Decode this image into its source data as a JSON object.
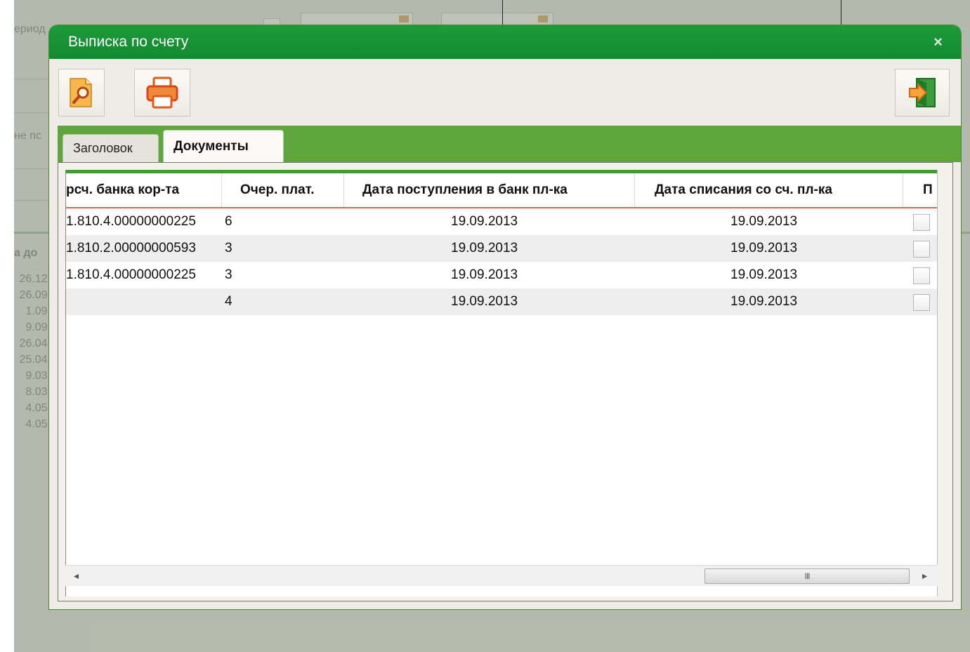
{
  "background": {
    "period_label": "ериод",
    "side_label": "не пс",
    "column_header_partial": "а до",
    "date_fragments": [
      "26.12.",
      "26.09.",
      "1.09.",
      "9.09.",
      "26.04.",
      "25.04.",
      "9.03.",
      "8.03.",
      "4.05.",
      "4.05."
    ]
  },
  "dialog": {
    "title": "Выписка по счету",
    "close_icon": "×"
  },
  "toolbar": {
    "search_icon": "search-icon",
    "print_icon": "print-icon",
    "exit_icon": "exit-icon"
  },
  "tabs": [
    {
      "label": "Заголовок",
      "active": false
    },
    {
      "label": "Документы",
      "active": true
    }
  ],
  "grid": {
    "columns": [
      "рсч. банка кор-та",
      "Очер. плат.",
      "Дата поступления в банк пл-ка",
      "Дата списания со сч. пл-ка",
      "П"
    ],
    "rows": [
      {
        "account": "1.810.4.00000000225",
        "priority": "6",
        "received": "19.09.2013",
        "debited": "19.09.2013",
        "checked": false
      },
      {
        "account": "1.810.2.00000000593",
        "priority": "3",
        "received": "19.09.2013",
        "debited": "19.09.2013",
        "checked": false
      },
      {
        "account": "1.810.4.00000000225",
        "priority": "3",
        "received": "19.09.2013",
        "debited": "19.09.2013",
        "checked": false
      },
      {
        "account": "",
        "priority": "4",
        "received": "19.09.2013",
        "debited": "19.09.2013",
        "checked": false
      }
    ]
  },
  "scrollbar": {
    "left_arrow": "◂",
    "right_arrow": "▸",
    "thumb_grip": "III"
  }
}
